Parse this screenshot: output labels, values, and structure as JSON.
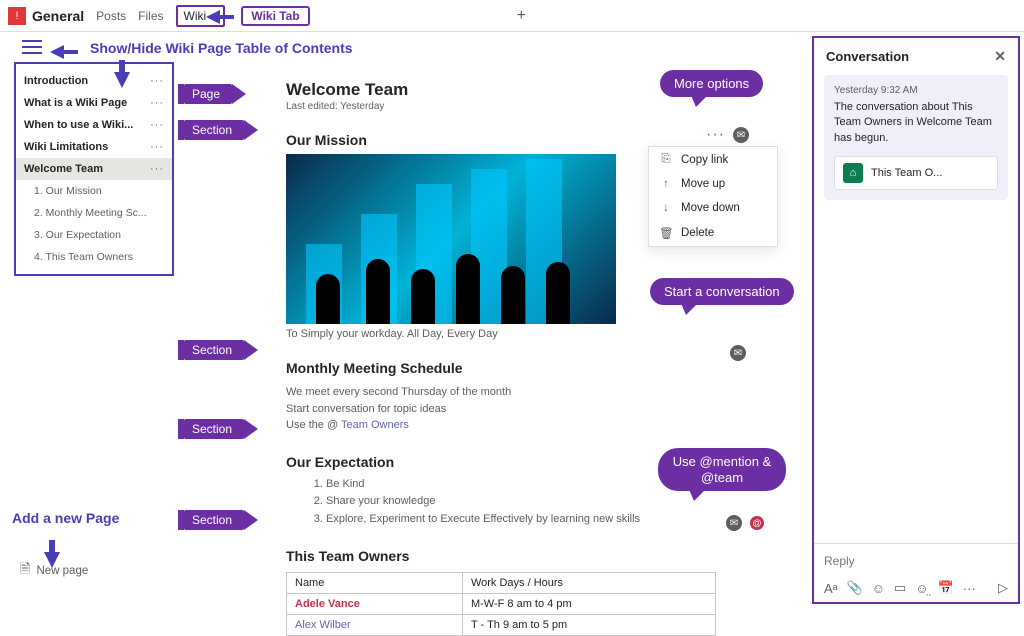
{
  "topbar": {
    "team_initial": "!",
    "team_name": "General",
    "tabs": [
      "Posts",
      "Files",
      "Wiki"
    ],
    "active_tab": "Wiki"
  },
  "annotations": {
    "wiki_tab": "Wiki Tab",
    "toc_toggle": "Show/Hide Wiki Page Table of Contents",
    "page": "Page",
    "section": "Section",
    "more_options": "More options",
    "start_conv": "Start a conversation",
    "mention": "Use @mention & @team",
    "add_page": "Add a new Page"
  },
  "toc": {
    "pages": [
      {
        "title": "Introduction"
      },
      {
        "title": "What is a Wiki Page"
      },
      {
        "title": "When to use a Wiki..."
      },
      {
        "title": "Wiki Limitations"
      },
      {
        "title": "Welcome Team",
        "active": true,
        "sections": [
          "1. Our Mission",
          "2. Monthly Meeting Sc...",
          "3. Our Expectation",
          "4. This Team Owners"
        ]
      }
    ]
  },
  "page": {
    "title": "Welcome Team",
    "last_edited": "Last edited: Yesterday",
    "mission": {
      "heading": "Our Mission",
      "caption": "To Simply your workday. All Day, Every Day"
    },
    "meeting": {
      "heading": "Monthly Meeting Schedule",
      "line1": "We meet every second Thursday of the month",
      "line2": "Start conversation for topic ideas",
      "line3_prefix": "Use the @ ",
      "line3_link": "Team Owners"
    },
    "expect": {
      "heading": "Our Expectation",
      "items": [
        "Be Kind",
        "Share your knowledge",
        "Explore, Experiment to Execute Effectively by learning new skills"
      ]
    },
    "owners": {
      "heading": "This Team Owners",
      "col_name": "Name",
      "col_hours": "Work Days / Hours",
      "rows": [
        {
          "name": "Adele Vance",
          "hours": "M-W-F 8 am to 4 pm",
          "cls": "name-adele"
        },
        {
          "name": "Alex Wilber",
          "hours": "T - Th 9 am to 5 pm",
          "cls": "name-alex"
        }
      ]
    }
  },
  "context_menu": {
    "items": [
      {
        "icon": "⎘",
        "label": "Copy link"
      },
      {
        "icon": "↑",
        "label": "Move up"
      },
      {
        "icon": "↓",
        "label": "Move down"
      },
      {
        "icon": "🗑",
        "label": "Delete"
      }
    ]
  },
  "conversation": {
    "header": "Conversation",
    "time": "Yesterday 9:32 AM",
    "text": "The conversation about This Team Owners in Welcome Team has begun.",
    "card_label": "This Team O...",
    "reply_placeholder": "Reply"
  },
  "new_page_label": "New page"
}
